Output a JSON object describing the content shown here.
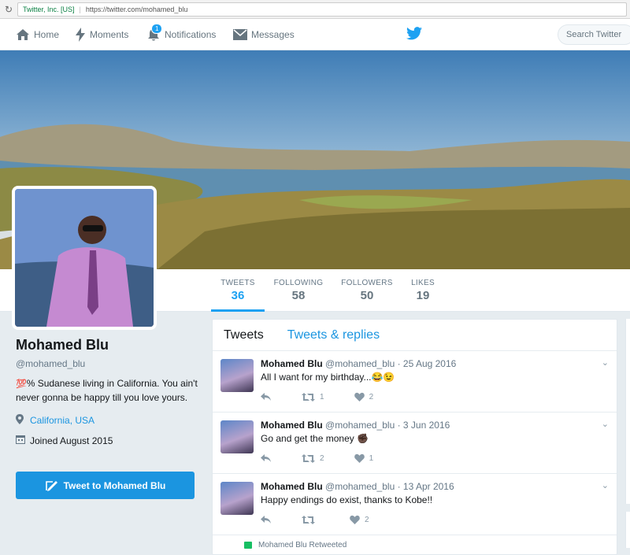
{
  "browser": {
    "secure_label": "Twitter, Inc. [US]",
    "url": "https://twitter.com/mohamed_blu"
  },
  "nav": {
    "home": "Home",
    "moments": "Moments",
    "notifications": "Notifications",
    "notifications_count": "1",
    "messages": "Messages",
    "search_placeholder": "Search Twitter"
  },
  "stats": {
    "tweets_label": "TWEETS",
    "tweets": "36",
    "following_label": "FOLLOWING",
    "following": "58",
    "followers_label": "FOLLOWERS",
    "followers": "50",
    "likes_label": "LIKES",
    "likes": "19"
  },
  "profile": {
    "name": "Mohamed Blu",
    "handle": "@mohamed_blu",
    "bio_emoji": "💯",
    "bio": "% Sudanese living in California. You ain't never gonna be happy till you love yours.",
    "location": "California, USA",
    "joined": "Joined August 2015",
    "tweet_to": "Tweet to Mohamed Blu"
  },
  "tabs": {
    "tweets": "Tweets",
    "replies": "Tweets & replies"
  },
  "tweets": [
    {
      "name": "Mohamed Blu",
      "handle": "@mohamed_blu",
      "date": "· 25 Aug 2016",
      "text": "All I want for my birthday...😂😉",
      "retweets": "1",
      "likes": "2"
    },
    {
      "name": "Mohamed Blu",
      "handle": "@mohamed_blu",
      "date": "· 3 Jun 2016",
      "text": "Go and get the money ✊🏿",
      "retweets": "2",
      "likes": "1"
    },
    {
      "name": "Mohamed Blu",
      "handle": "@mohamed_blu",
      "date": "· 13 Apr 2016",
      "text": "Happy endings do exist, thanks to Kobe!!",
      "retweets": "",
      "likes": "2"
    }
  ],
  "retweeted_note": "Mohamed Blu Retweeted",
  "colors": {
    "accent": "#1da1f2",
    "link": "#1b95e0",
    "bg": "#e6ecf0"
  }
}
